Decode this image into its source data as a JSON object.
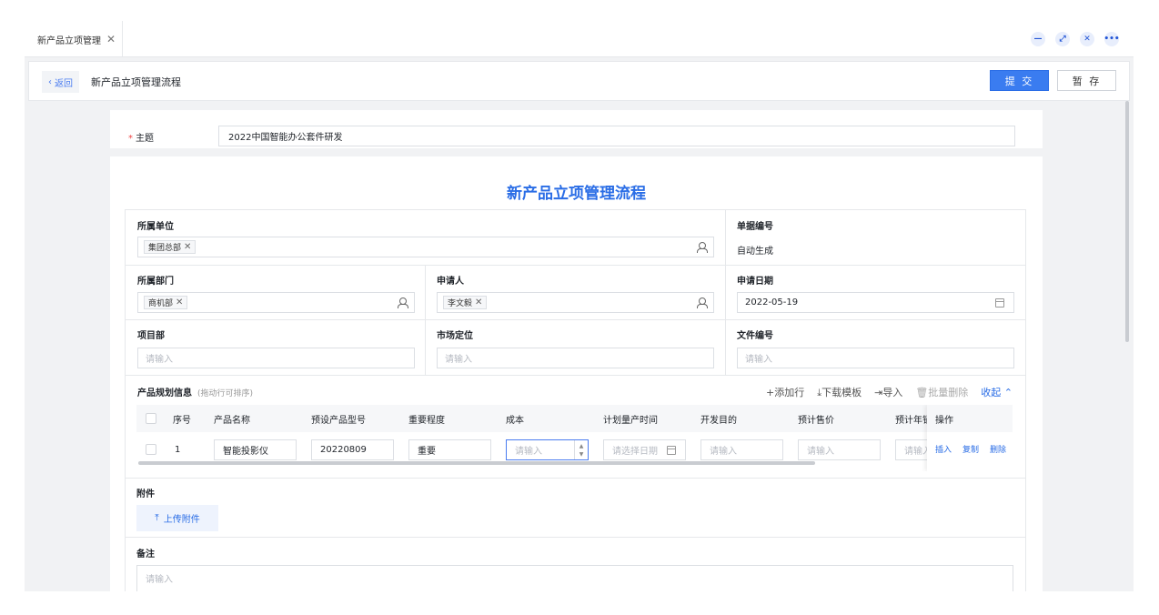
{
  "tab": {
    "label": "新产品立项管理"
  },
  "header": {
    "back_label": "返回",
    "title": "新产品立项管理流程",
    "submit_label": "提 交",
    "save_label": "暂 存"
  },
  "subject": {
    "label": "主题",
    "value": "2022中国智能办公套件研发"
  },
  "form": {
    "title": "新产品立项管理流程",
    "unit": {
      "label": "所属单位",
      "tag": "集团总部"
    },
    "doc_no": {
      "label": "单据编号",
      "value": "自动生成"
    },
    "dept": {
      "label": "所属部门",
      "tag": "商机部"
    },
    "applicant": {
      "label": "申请人",
      "tag": "李文毅"
    },
    "apply_date": {
      "label": "申请日期",
      "value": "2022-05-19"
    },
    "project": {
      "label": "项目部",
      "placeholder": "请输入"
    },
    "market": {
      "label": "市场定位",
      "placeholder": "请输入"
    },
    "file_no": {
      "label": "文件编号",
      "placeholder": "请输入"
    }
  },
  "plan": {
    "title": "产品规划信息",
    "hint": "(拖动行可排序)",
    "tools": {
      "add": "+添加行",
      "download": "下载模板",
      "import": "导入",
      "batch_delete": "批量删除",
      "collapse": "收起"
    },
    "columns": [
      "序号",
      "产品名称",
      "预设产品型号",
      "重要程度",
      "成本",
      "计划量产时间",
      "开发目的",
      "预计售价",
      "预计年销",
      "操作"
    ],
    "row": {
      "index": "1",
      "name": "智能投影仪",
      "model": "20220809",
      "importance": "重要",
      "cost_ph": "请输入",
      "date_ph": "请选择日期",
      "purpose_ph": "请输入",
      "price_ph": "请输入",
      "annual_ph": "请输入"
    },
    "ops": {
      "insert": "插入",
      "copy": "复制",
      "delete": "删除"
    }
  },
  "attachment": {
    "label": "附件",
    "upload": "上传附件"
  },
  "remark": {
    "label": "备注",
    "placeholder": "请输入"
  }
}
